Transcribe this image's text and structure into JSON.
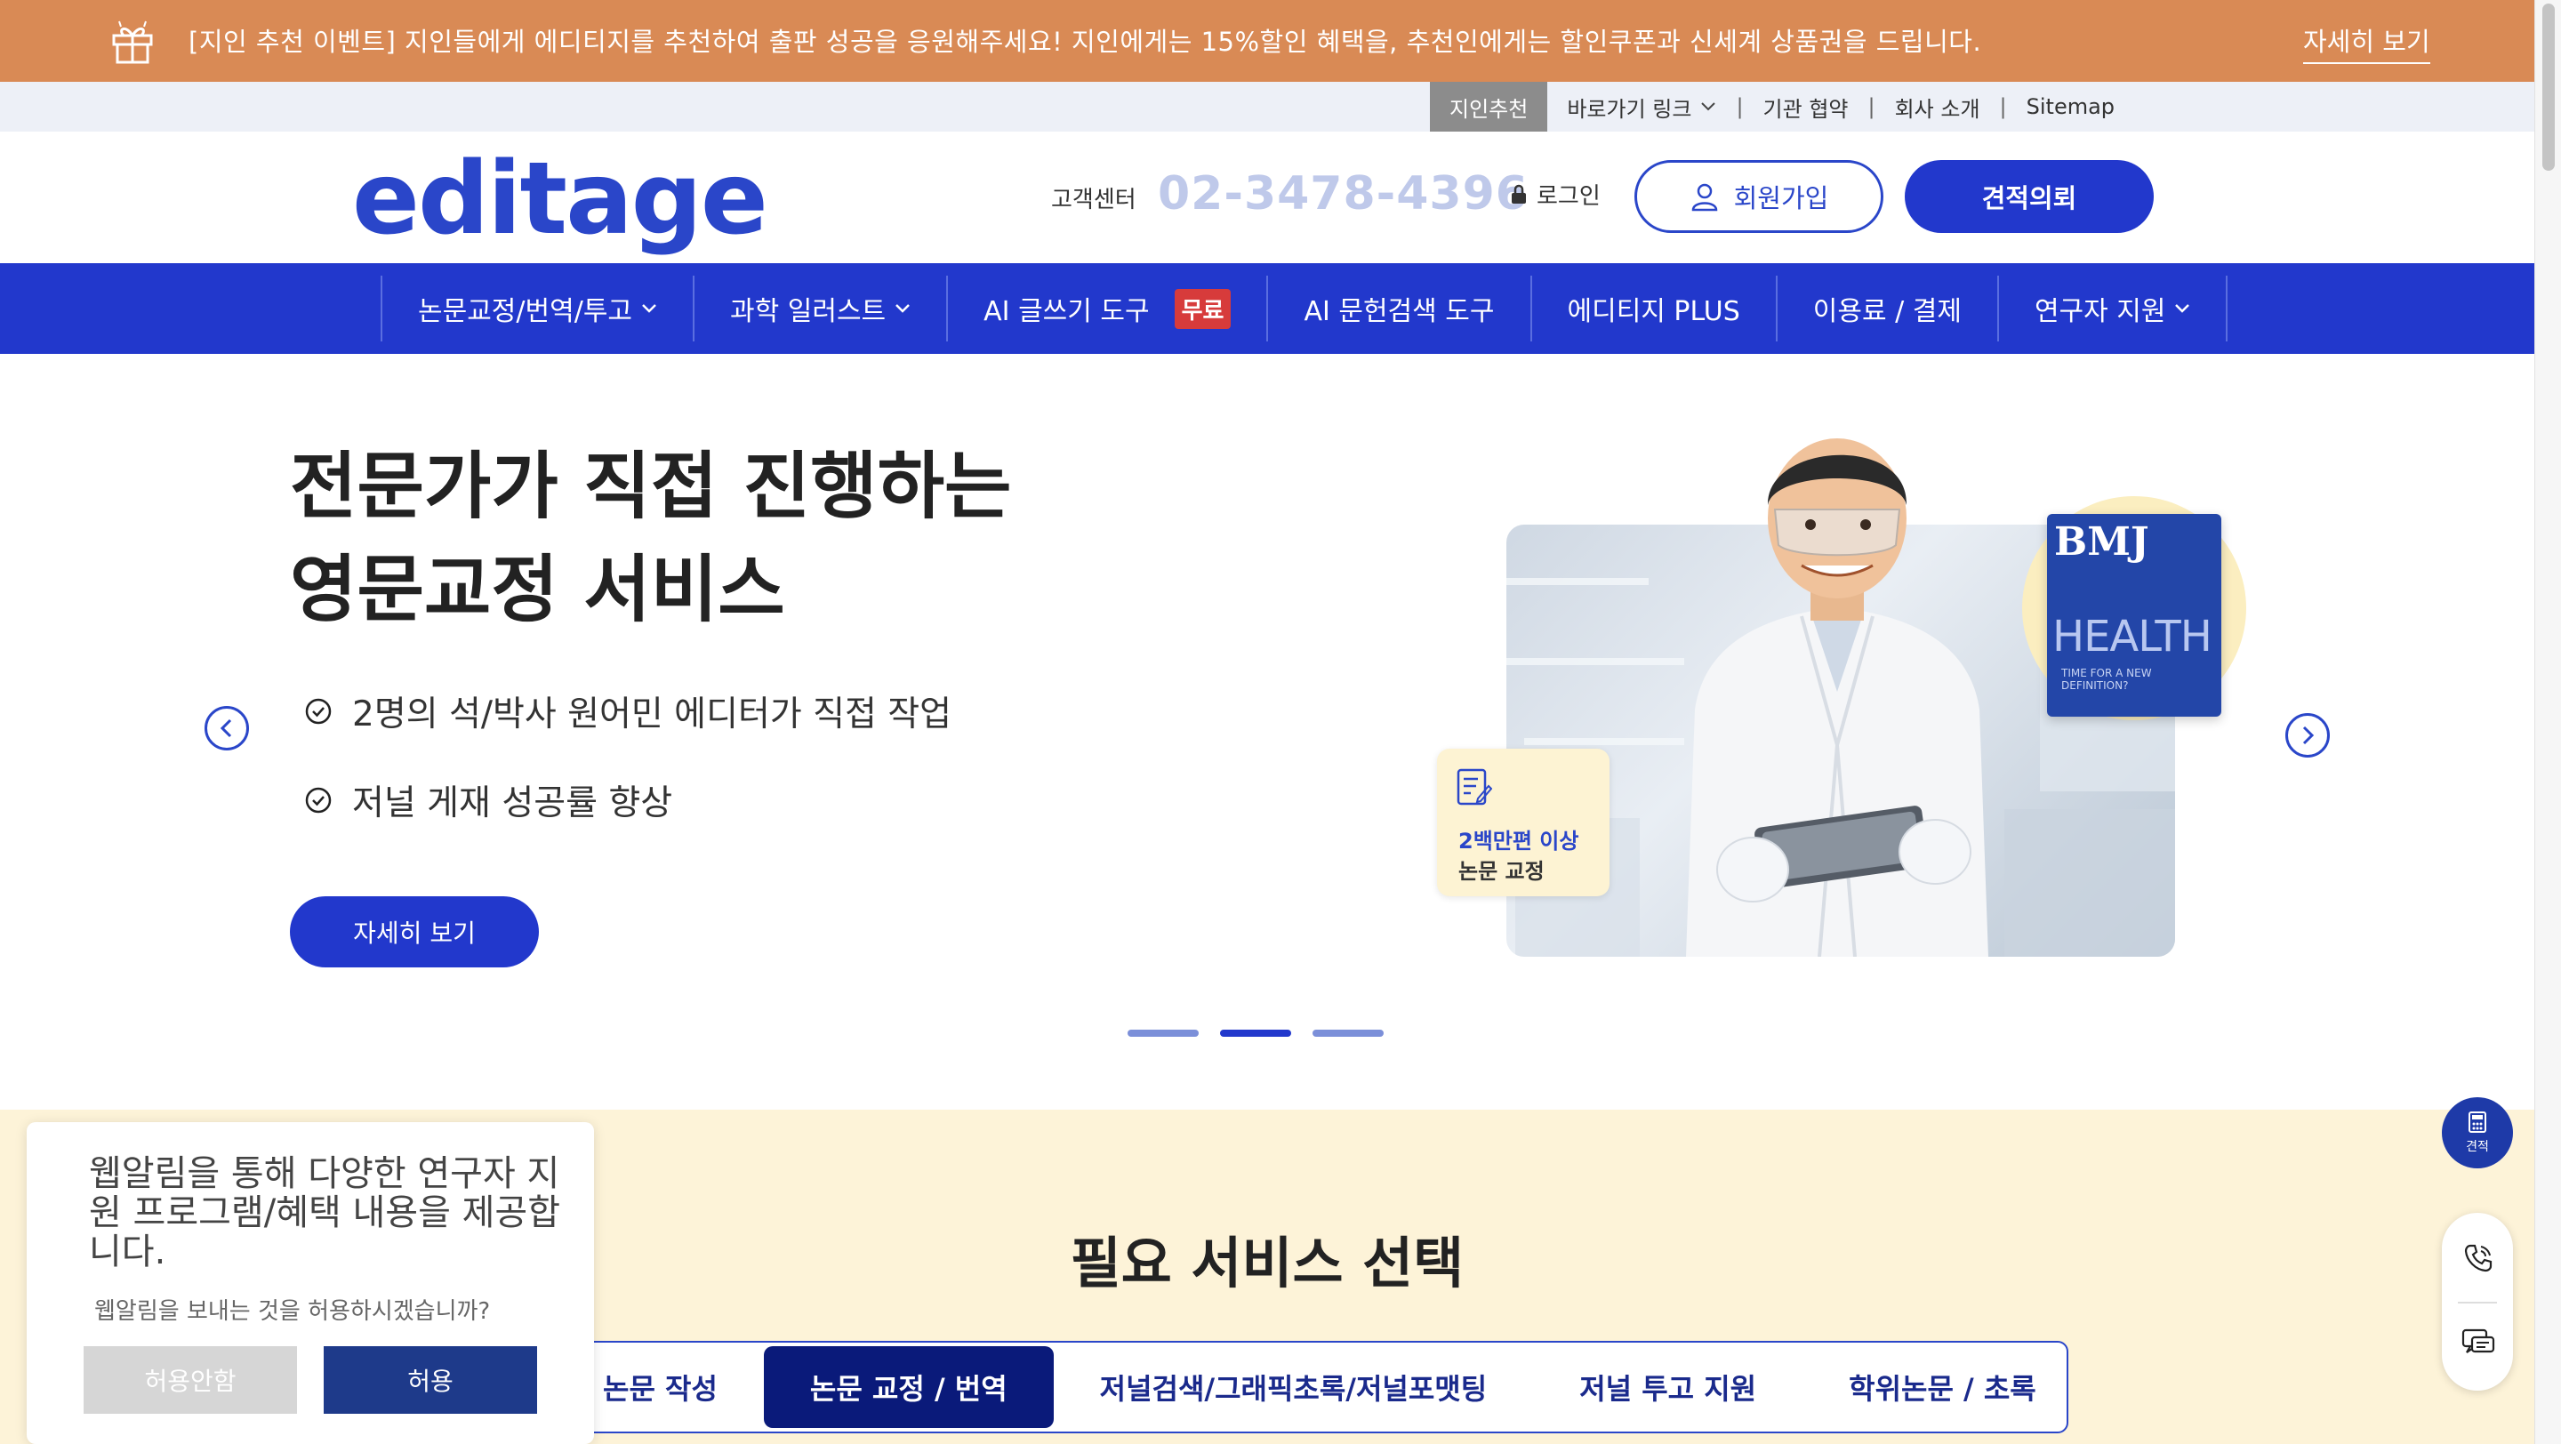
{
  "promo": {
    "text": "[지인 추천 이벤트] 지인들에게 에디티지를 추천하여 출판 성공을 응원해주세요! 지인에게는 15%할인 혜택을, 추천인에게는 할인쿠폰과 신세계 상품권을 드립니다.",
    "link": "자세히 보기",
    "icon": "gift-icon",
    "color": "#d98a55"
  },
  "utility": {
    "highlight": "지인추천",
    "items": [
      "바로가기 링크",
      "기관 협약",
      "회사 소개",
      "Sitemap"
    ],
    "separator": "|"
  },
  "header": {
    "logo": "editage",
    "cs_label": "고객센터",
    "cs_phone": "02-3478-4396",
    "login": "로그인",
    "signup": "회원가입",
    "quote": "견적의뢰",
    "brand_color": "#2238cc"
  },
  "nav": {
    "items": [
      {
        "label": "논문교정/번역/투고",
        "dropdown": true
      },
      {
        "label": "과학 일러스트",
        "dropdown": true
      },
      {
        "label": "AI 글쓰기 도구",
        "badge": "무료"
      },
      {
        "label": "AI 문헌검색 도구"
      },
      {
        "label": "에디티지 PLUS"
      },
      {
        "label": "이용료 / 결제"
      },
      {
        "label": "연구자 지원",
        "dropdown": true
      }
    ]
  },
  "hero": {
    "title": "전문가가 직접 진행하는\n영문교정 서비스",
    "features": [
      "2명의 석/박사 원어민 에디터가 직접 작업",
      "저널 게재 성공률 향상"
    ],
    "cta": "자세히 보기",
    "stat_line1": "2백만편 이상",
    "stat_line2": "논문 교정",
    "journal_name": "BMJ",
    "journal_cover_title": "HEALTH",
    "journal_cover_sub": "TIME FOR A NEW DEFINITION?",
    "slides_total": 3,
    "slide_active": 2
  },
  "services": {
    "title": "필요 서비스 선택",
    "tabs": [
      {
        "label": "논문 작성",
        "active": false
      },
      {
        "label": "논문 교정 / 번역",
        "active": true
      },
      {
        "label": "저널검색/그래픽초록/저널포맷팅",
        "active": false
      },
      {
        "label": "저널 투고 지원",
        "active": false
      },
      {
        "label": "학위논문 / 초록",
        "active": false
      }
    ]
  },
  "notify": {
    "title": "웹알림을 통해 다양한 연구자 지원 프로그램/혜택 내용을 제공합니다.",
    "question": "웹알림을 보내는 것을 허용하시겠습니까?",
    "deny": "허용안함",
    "allow": "허용"
  },
  "floating": {
    "quote_label": "견적"
  }
}
